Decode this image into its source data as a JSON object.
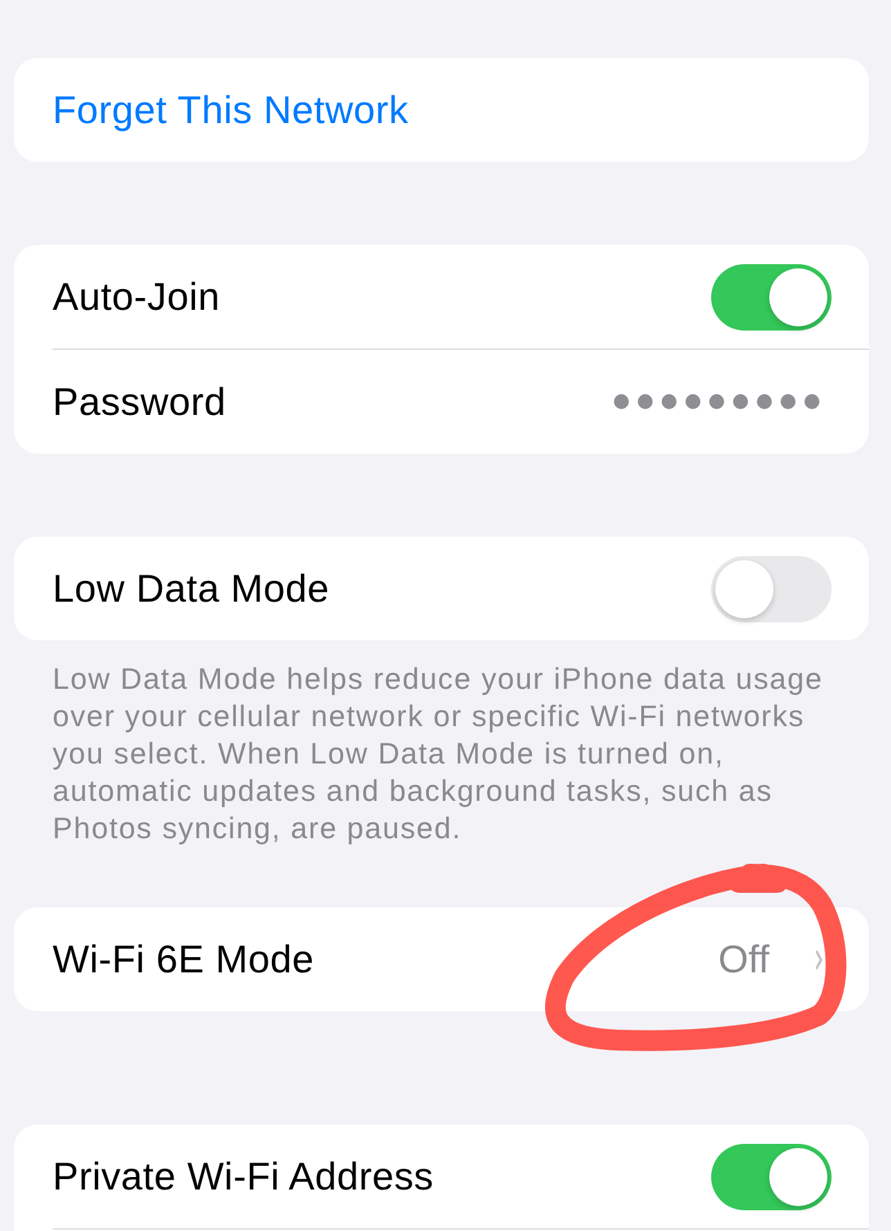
{
  "sections": [
    {
      "rows": [
        {
          "kind": "action",
          "label": "Forget This Network",
          "circled": false
        }
      ]
    },
    {
      "rows": [
        {
          "kind": "toggle",
          "label": "Auto-Join",
          "on": true,
          "circled": false
        },
        {
          "kind": "secret",
          "label": "Password",
          "value": "●●●●●●●●●",
          "circled": false
        }
      ]
    },
    {
      "rows": [
        {
          "kind": "toggle",
          "label": "Low Data Mode",
          "on": false,
          "circled": false
        }
      ],
      "footer": "Low Data Mode helps reduce your iPhone data usage over your cellular network or specific Wi-Fi networks you select. When Low Data Mode is turned on, automatic updates and background tasks, such as Photos syncing, are paused."
    },
    {
      "rows": [
        {
          "kind": "link",
          "label": "Wi-Fi 6E Mode",
          "value": "Off",
          "circled": true
        }
      ]
    },
    {
      "rows": [
        {
          "kind": "toggle",
          "label": "Private Wi-Fi Address",
          "on": true,
          "circled": false
        }
      ],
      "more_below": true
    }
  ]
}
